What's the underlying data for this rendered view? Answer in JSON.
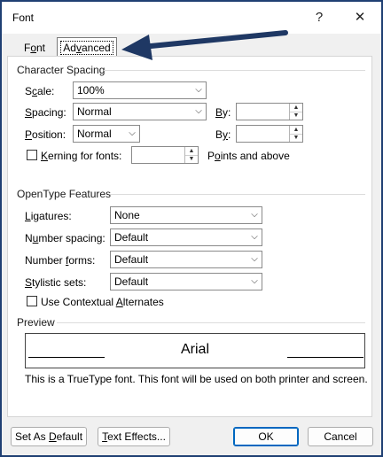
{
  "window": {
    "title": "Font",
    "help": "?",
    "close": "✕"
  },
  "tabs": [
    {
      "label": "Font",
      "underline": "n"
    },
    {
      "label": "Advanced",
      "underline": "v"
    }
  ],
  "character_spacing": {
    "title": "Character Spacing",
    "scale": {
      "label": "Scale:",
      "value": "100%"
    },
    "spacing": {
      "label": "Spacing:",
      "value": "Normal",
      "by_label": "By:"
    },
    "position": {
      "label": "Position:",
      "value": "Normal",
      "by_label": "By:"
    },
    "kerning": {
      "label": "Kerning for fonts:",
      "suffix": "Points and above",
      "checked": false
    }
  },
  "opentype": {
    "title": "OpenType Features",
    "ligatures": {
      "label": "Ligatures:",
      "value": "None"
    },
    "number_spacing": {
      "label": "Number spacing:",
      "value": "Default"
    },
    "number_forms": {
      "label": "Number forms:",
      "value": "Default"
    },
    "stylistic_sets": {
      "label": "Stylistic sets:",
      "value": "Default"
    },
    "contextual_alternates": {
      "label": "Use Contextual Alternates",
      "checked": false
    }
  },
  "preview": {
    "title": "Preview",
    "sample": "Arial",
    "description": "This is a TrueType font. This font will be used on both printer and screen."
  },
  "buttons": {
    "set_default": "Set As Default",
    "text_effects": "Text Effects...",
    "ok": "OK",
    "cancel": "Cancel"
  },
  "colors": {
    "frame": "#1f3f73",
    "annotation_arrow": "#1f3864",
    "ok_border": "#0067c0"
  }
}
